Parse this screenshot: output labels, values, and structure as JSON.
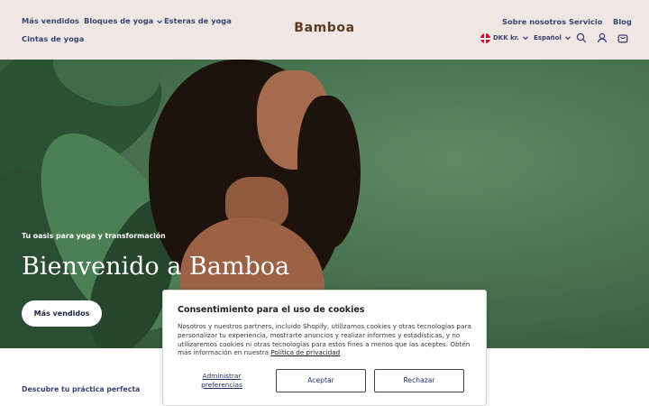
{
  "header": {
    "nav_left": [
      "Más vendidos",
      "Bloques de yoga",
      "Esteras de yoga",
      "Cintas de yoga"
    ],
    "logo": "Bamboa",
    "nav_right": [
      "Sobre nosotros",
      "Servicio",
      "Blog"
    ],
    "currency": "DKK kr.",
    "language": "Español",
    "icons": [
      "search-icon",
      "account-icon",
      "cart-icon",
      "chevron-down-icon",
      "denmark-flag-icon"
    ]
  },
  "hero": {
    "tagline": "Tu oasis para yoga y transformación",
    "title": "Bienvenido a Bamboa",
    "button": "Más vendidos"
  },
  "section": {
    "subtitle": "Descubre tu práctica perfecta"
  },
  "cookie_banner": {
    "title": "Consentimiento para el uso de cookies",
    "body": "Nosotros y nuestros partners, incluido Shopify, utilizamos cookies y otras tecnologías para personalizar tu experiencia, mostrarte anuncios y realizar informes y estadísticas, y no utilizaremos cookies ni otras tecnologías para estos fines a menos que las aceptes. Obtén más información en nuestra",
    "privacy_link": "Política de privacidad",
    "manage": "Administrar preferencias",
    "accept": "Aceptar",
    "reject": "Rechazar"
  },
  "colors": {
    "header_bg": "#f0e7e5",
    "nav_text": "#3a4270",
    "logo": "#5c3b24",
    "hero_green": "#4a7552"
  }
}
